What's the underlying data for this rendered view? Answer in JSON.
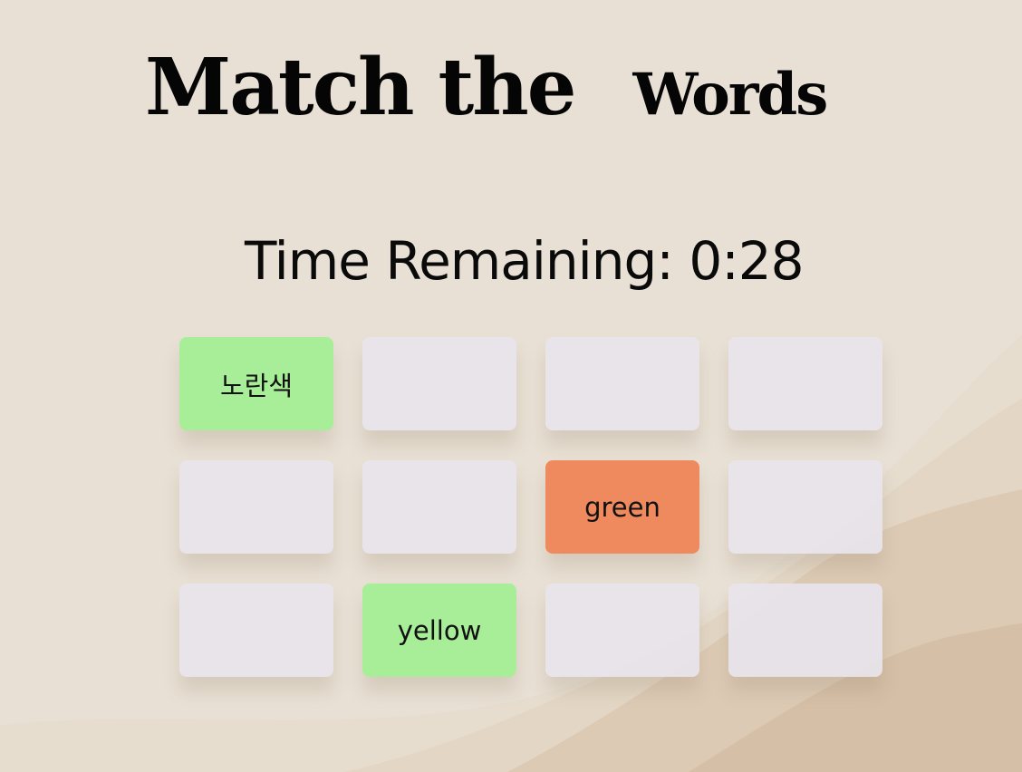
{
  "title": {
    "part1": "Match the",
    "part2": "Words"
  },
  "timer": {
    "text": "Time Remaining: 0:28"
  },
  "colors": {
    "matched": "#a8ee98",
    "wrong": "#ef895e",
    "hidden": "#e8e4ec"
  },
  "cards": [
    {
      "label": "노란색",
      "state": "matched"
    },
    {
      "label": "",
      "state": "hidden"
    },
    {
      "label": "",
      "state": "hidden"
    },
    {
      "label": "",
      "state": "hidden"
    },
    {
      "label": "",
      "state": "hidden"
    },
    {
      "label": "",
      "state": "hidden"
    },
    {
      "label": "green",
      "state": "wrong"
    },
    {
      "label": "",
      "state": "hidden"
    },
    {
      "label": "",
      "state": "hidden"
    },
    {
      "label": "yellow",
      "state": "matched"
    },
    {
      "label": "",
      "state": "hidden"
    },
    {
      "label": "",
      "state": "hidden"
    }
  ]
}
